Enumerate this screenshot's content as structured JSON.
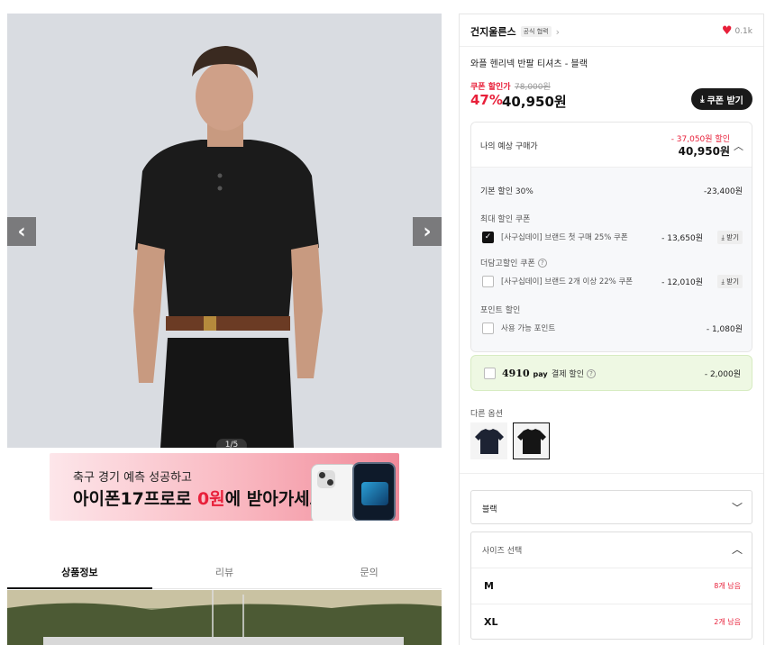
{
  "gallery": {
    "page_indicator": "1/5",
    "prev_icon": "chevron-left-icon",
    "next_icon": "chevron-right-icon"
  },
  "banner": {
    "line1": "축구 경기 예측 성공하고",
    "line2_pre": "아이폰17프로로 ",
    "line2_red": "0원",
    "line2_post": "에 받아가세요"
  },
  "tabs": [
    {
      "label": "상품정보",
      "active": true
    },
    {
      "label": "리뷰",
      "active": false
    },
    {
      "label": "문의",
      "active": false
    }
  ],
  "product": {
    "brand": "건지울른스",
    "official_badge": "공식 협력",
    "likes": "0.1k",
    "name": "와플 헨리넥 반팔 티셔츠 - 블랙",
    "coupon_price_label": "쿠폰 할인가",
    "original_price": "78,000원",
    "discount_pct": "47%",
    "final_price": "40,950원",
    "coupon_button": "쿠폰 받기"
  },
  "calc": {
    "label": "나의 예상 구매가",
    "saving": "- 37,050원 할인",
    "estimate": "40,950원",
    "base_discount_label": "기본 할인 30%",
    "base_discount_amount": "-23,400원",
    "max_coupon_title": "최대 할인 쿠폰",
    "coupon1_label": "[사구십데이] 브랜드 첫 구매 25% 쿠폰",
    "coupon1_amount": "- 13,650원",
    "coupon1_get": "받기",
    "extra_coupon_title": "더담고할인 쿠폰",
    "coupon2_label": "[사구십데이] 브랜드 2개 이상 22% 쿠폰",
    "coupon2_amount": "- 12,010원",
    "coupon2_get": "받기",
    "point_title": "포인트 할인",
    "point_label": "사용 가능 포인트",
    "point_amount": "- 1,080원"
  },
  "pay": {
    "logo_main": "4910",
    "logo_sub": "pay",
    "label": "결제 할인",
    "amount": "- 2,000원"
  },
  "options": {
    "label": "다른 옵션"
  },
  "color_select": {
    "value": "블랙"
  },
  "size_select": {
    "placeholder": "사이즈 선택",
    "items": [
      {
        "name": "M",
        "stock": "8개 남음"
      },
      {
        "name": "XL",
        "stock": "2개 남음"
      }
    ]
  },
  "colors": {
    "accent_red": "#e8203a",
    "pay_bg": "#eef8e3",
    "hero_bg": "#d8dbe0"
  }
}
